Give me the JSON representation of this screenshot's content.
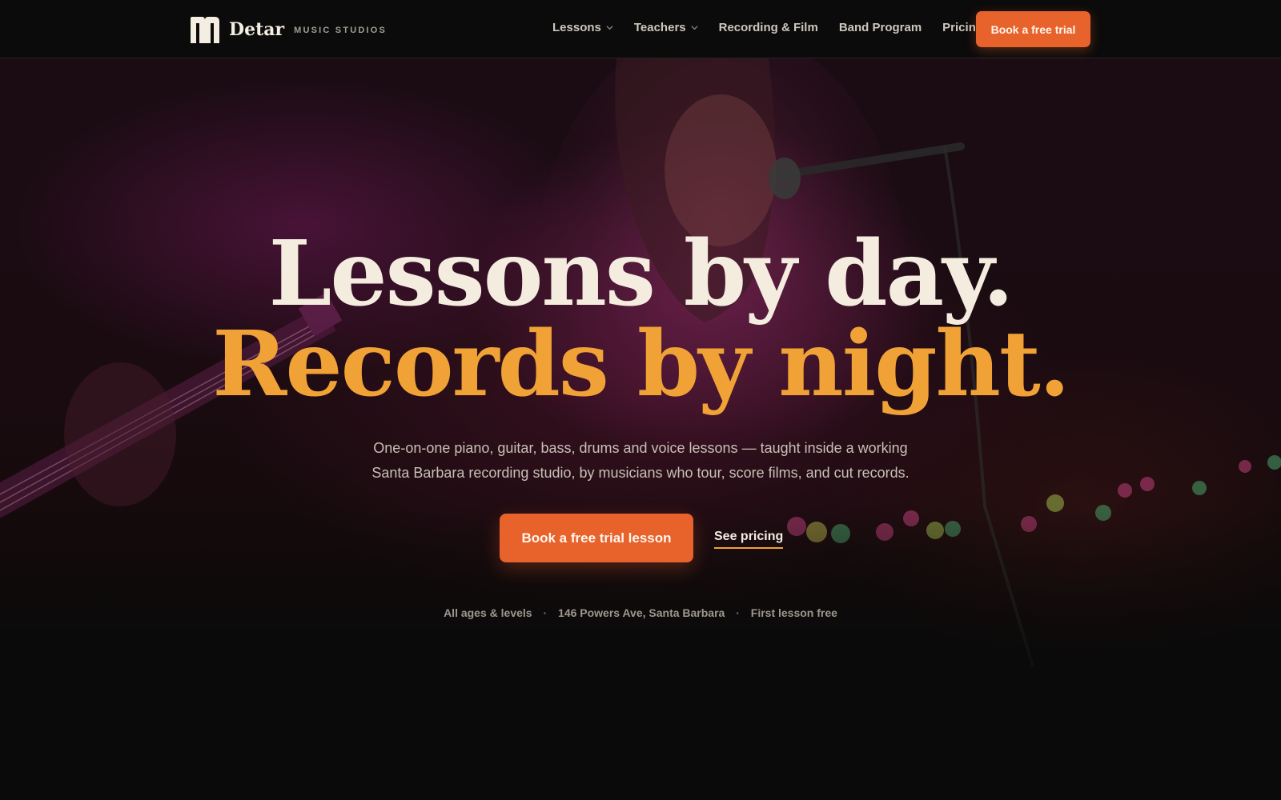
{
  "brand": {
    "name": "Detar",
    "subtitle": "MUSIC STUDIOS",
    "logo_icon": "m-monogram-icon"
  },
  "nav": {
    "items": [
      {
        "label": "Lessons",
        "has_dropdown": true
      },
      {
        "label": "Teachers",
        "has_dropdown": true
      },
      {
        "label": "Recording & Film",
        "has_dropdown": false
      },
      {
        "label": "Band Program",
        "has_dropdown": false
      },
      {
        "label": "Pricing",
        "has_dropdown": false
      }
    ],
    "cta_label": "Book a free trial"
  },
  "hero": {
    "headline_line1": "Lessons by day.",
    "headline_line2": "Records by night.",
    "subtext_line1": "One-on-one piano, guitar, bass, drums and voice lessons — taught inside a working",
    "subtext_line2": "Santa Barbara recording studio, by musicians who tour, score films, and cut records.",
    "primary_cta": "Book a free trial lesson",
    "secondary_link": "See pricing",
    "facts": [
      "All ages & levels",
      "146 Powers Ave, Santa Barbara",
      "First lesson free"
    ],
    "fact_separator": "·"
  },
  "colors": {
    "background": "#0a0a0a",
    "accent": "#e8622c",
    "headline_primary": "#f5ece0",
    "headline_secondary": "#f0a236",
    "nav_text": "#cdc7bd"
  }
}
